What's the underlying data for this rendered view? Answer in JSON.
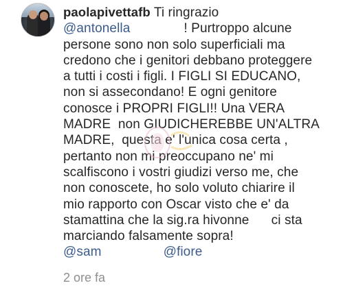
{
  "comment": {
    "username": "paolapivettafb",
    "first_text": "Ti ringrazio",
    "mention_start": "@antonella",
    "lines": [
      "! Purtroppo alcune",
      "persone sono non solo superficiali ma",
      "credono che i genitori debbano proteggere",
      "a tutti i costi i figli. I FIGLI SI EDUCANO,",
      "non si assecondano! E ogni genitore",
      "conosce i PROPRI FIGLI!! Una VERA",
      "MADRE  non GIUDICHEREBBE UN'ALTRA",
      "MADRE,  questa e' l'unica cosa certa ,",
      "pertanto non mi preoccupano ne' mi",
      "scalfiscono i vostri giudizi verso me, che",
      "non conoscete, ho solo voluto chiarire il",
      "mio rapporto con Oscar visto che e' da",
      "stamattina che la sig.ra hivonne      ci sta",
      "marciando falsamente sopra!"
    ],
    "mention_1": "@sam",
    "mention_2": "@fiore",
    "timestamp": "2 ore fa"
  },
  "colors": {
    "text": "#262626",
    "mention": "#3b5b8c",
    "muted": "#8e8e8e"
  }
}
